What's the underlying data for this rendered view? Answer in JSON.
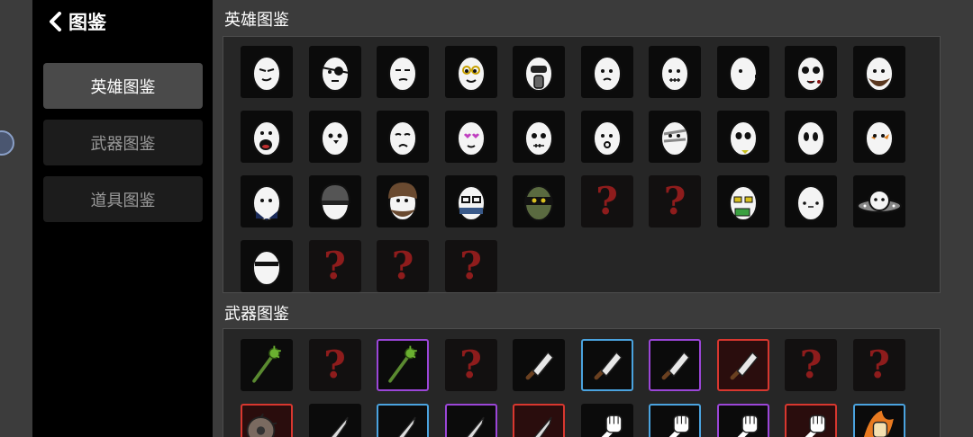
{
  "sidebar": {
    "back_title": "图鉴",
    "nav": [
      {
        "label": "英雄图鉴",
        "active": true
      },
      {
        "label": "武器图鉴",
        "active": false
      },
      {
        "label": "道具图鉴",
        "active": false
      }
    ]
  },
  "heroes": {
    "title": "英雄图鉴",
    "tiles": [
      {
        "icon": "egg-hero-smirk-icon",
        "known": true
      },
      {
        "icon": "egg-hero-eyepatch-icon",
        "known": true
      },
      {
        "icon": "egg-hero-smug-icon",
        "known": true
      },
      {
        "icon": "egg-hero-goggles-icon",
        "known": true
      },
      {
        "icon": "egg-hero-gasmask-icon",
        "known": true
      },
      {
        "icon": "egg-hero-pout-icon",
        "known": true
      },
      {
        "icon": "egg-hero-stitched-icon",
        "known": true
      },
      {
        "icon": "egg-hero-chick-icon",
        "known": true
      },
      {
        "icon": "egg-hero-bloody-icon",
        "known": true
      },
      {
        "icon": "egg-hero-bearded-icon",
        "known": true
      },
      {
        "icon": "egg-hero-screaming-icon",
        "known": true
      },
      {
        "icon": "egg-hero-bird-icon",
        "known": true
      },
      {
        "icon": "egg-hero-sad-icon",
        "known": true
      },
      {
        "icon": "egg-hero-heart-eyes-icon",
        "known": true
      },
      {
        "icon": "egg-hero-grumpy-icon",
        "known": true
      },
      {
        "icon": "egg-hero-surprised-icon",
        "known": true
      },
      {
        "icon": "egg-hero-bandaged-icon",
        "known": true
      },
      {
        "icon": "egg-hero-panda-icon",
        "known": true
      },
      {
        "icon": "egg-hero-ghost-icon",
        "known": true
      },
      {
        "icon": "egg-hero-fire-icon",
        "known": true
      },
      {
        "icon": "egg-hero-suit-icon",
        "known": true
      },
      {
        "icon": "egg-hero-helmet-icon",
        "known": true
      },
      {
        "icon": "egg-hero-hairy-icon",
        "known": true
      },
      {
        "icon": "egg-hero-nerd-mask-icon",
        "known": true
      },
      {
        "icon": "egg-hero-ninja-icon",
        "known": true
      },
      {
        "icon": "locked-question-icon",
        "known": false
      },
      {
        "icon": "locked-question-icon",
        "known": false
      },
      {
        "icon": "egg-hero-money-glasses-icon",
        "known": true
      },
      {
        "icon": "egg-hero-plain-icon",
        "known": true
      },
      {
        "icon": "egg-hero-ufo-icon",
        "known": true
      },
      {
        "icon": "egg-hero-sunglasses-icon",
        "known": true
      },
      {
        "icon": "locked-question-icon",
        "known": false
      },
      {
        "icon": "locked-question-icon",
        "known": false
      },
      {
        "icon": "locked-question-icon",
        "known": false
      }
    ]
  },
  "weapons": {
    "title": "武器图鉴",
    "tiles": [
      {
        "icon": "green-mace-icon",
        "known": true,
        "rarity": "none"
      },
      {
        "icon": "locked-question-icon",
        "known": false,
        "rarity": "none"
      },
      {
        "icon": "green-mace-icon",
        "known": true,
        "rarity": "purple"
      },
      {
        "icon": "locked-question-icon",
        "known": false,
        "rarity": "none"
      },
      {
        "icon": "cleaver-icon",
        "known": true,
        "rarity": "none"
      },
      {
        "icon": "cleaver-icon",
        "known": true,
        "rarity": "blue"
      },
      {
        "icon": "cleaver-icon",
        "known": true,
        "rarity": "purple"
      },
      {
        "icon": "cleaver-icon",
        "known": true,
        "rarity": "red"
      },
      {
        "icon": "locked-question-icon",
        "known": false,
        "rarity": "none"
      },
      {
        "icon": "locked-question-icon",
        "known": false,
        "rarity": "none"
      },
      {
        "icon": "saw-blade-icon",
        "known": true,
        "rarity": "red"
      },
      {
        "icon": "knife-icon",
        "known": true,
        "rarity": "none"
      },
      {
        "icon": "knife-icon",
        "known": true,
        "rarity": "blue"
      },
      {
        "icon": "knife-icon",
        "known": true,
        "rarity": "purple"
      },
      {
        "icon": "knife-icon",
        "known": true,
        "rarity": "red"
      },
      {
        "icon": "fist-icon",
        "known": true,
        "rarity": "none"
      },
      {
        "icon": "fist-icon",
        "known": true,
        "rarity": "blue"
      },
      {
        "icon": "fist-icon",
        "known": true,
        "rarity": "purple"
      },
      {
        "icon": "fist-icon",
        "known": true,
        "rarity": "red"
      },
      {
        "icon": "flaming-fist-icon",
        "known": true,
        "rarity": "blue"
      }
    ]
  },
  "question_mark": "?",
  "colors": {
    "sidebar_bg": "#000000",
    "active_tab": "#4a4a4a",
    "panel_bg": "#262626",
    "question": "#8e1c1c",
    "rarity_blue": "#4aa3df",
    "rarity_purple": "#9b46d8",
    "rarity_red": "#d8372f"
  }
}
